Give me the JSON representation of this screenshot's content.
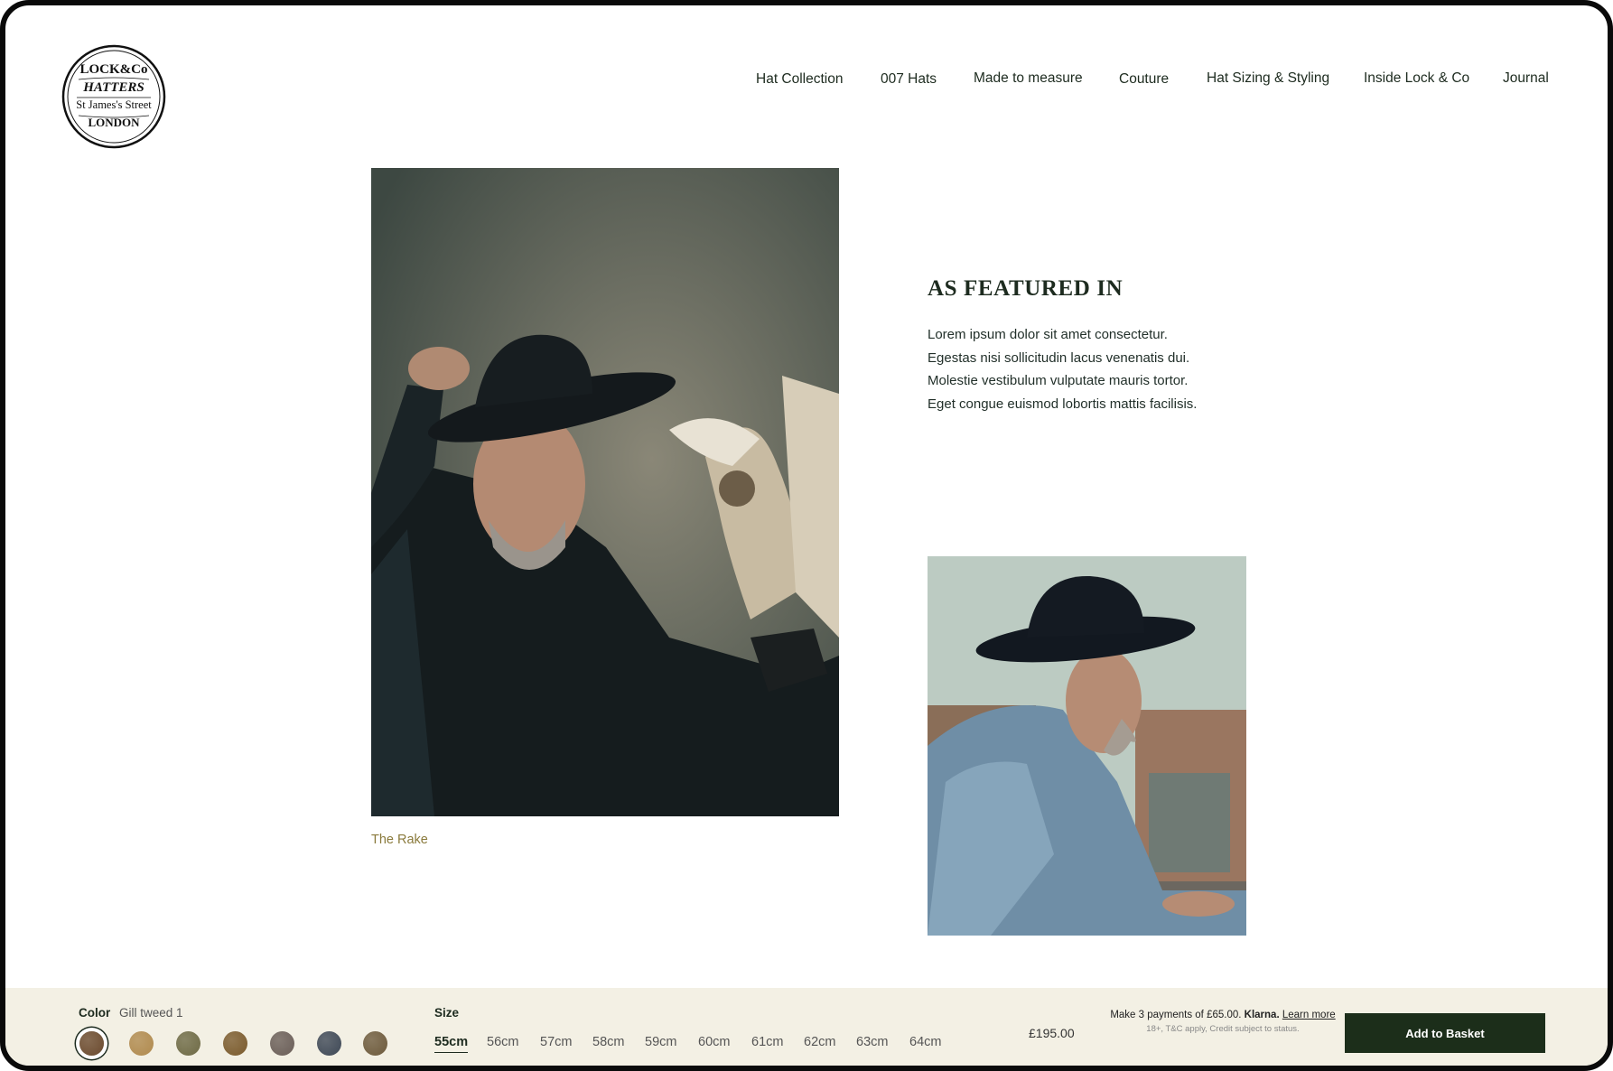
{
  "brand": {
    "logo_text": [
      "LOCK&Co",
      "HATTERS",
      "St James's Street",
      "LONDON"
    ]
  },
  "nav": {
    "items": [
      {
        "label": "Hat Collection"
      },
      {
        "label": "007 Hats"
      },
      {
        "label": "Made to measure"
      },
      {
        "label": "Couture"
      },
      {
        "label": "Hat Sizing & Styling"
      },
      {
        "label": "Inside Lock & Co"
      },
      {
        "label": "Journal"
      }
    ]
  },
  "main": {
    "caption": "The Rake",
    "featured": {
      "title": "AS FEATURED IN",
      "lines": [
        "Lorem ipsum dolor sit amet consectetur.",
        "Egestas nisi sollicitudin lacus venenatis dui.",
        "Molestie vestibulum vulputate mauris tortor.",
        "Eget congue euismod lobortis mattis facilisis."
      ]
    }
  },
  "purchase_bar": {
    "color_label": "Color",
    "color_value": "Gill tweed 1",
    "swatches": [
      {
        "color": "#6b4a2e",
        "selected": true
      },
      {
        "color": "#b08a4e",
        "selected": false
      },
      {
        "color": "#6e6a45",
        "selected": false
      },
      {
        "color": "#7a5a2c",
        "selected": false
      },
      {
        "color": "#6a5e58",
        "selected": false
      },
      {
        "color": "#3e4856",
        "selected": false
      },
      {
        "color": "#6d5a3c",
        "selected": false
      }
    ],
    "size_label": "Size",
    "sizes": [
      {
        "label": "55cm",
        "selected": true
      },
      {
        "label": "56cm",
        "selected": false
      },
      {
        "label": "57cm",
        "selected": false
      },
      {
        "label": "58cm",
        "selected": false
      },
      {
        "label": "59cm",
        "selected": false
      },
      {
        "label": "60cm",
        "selected": false
      },
      {
        "label": "61cm",
        "selected": false
      },
      {
        "label": "62cm",
        "selected": false
      },
      {
        "label": "63cm",
        "selected": false
      },
      {
        "label": "64cm",
        "selected": false
      }
    ],
    "price": "£195.00",
    "klarna_text": "Make 3 payments of £65.00.",
    "klarna_brand": "Klarna.",
    "klarna_link": "Learn more",
    "klarna_terms": "18+, T&C apply, Credit subject to status.",
    "add_to_basket": "Add to Basket"
  },
  "colors": {
    "accent": "#1c2e1a",
    "bar_bg": "#f3f0e4",
    "caption": "#8a7a3c"
  }
}
